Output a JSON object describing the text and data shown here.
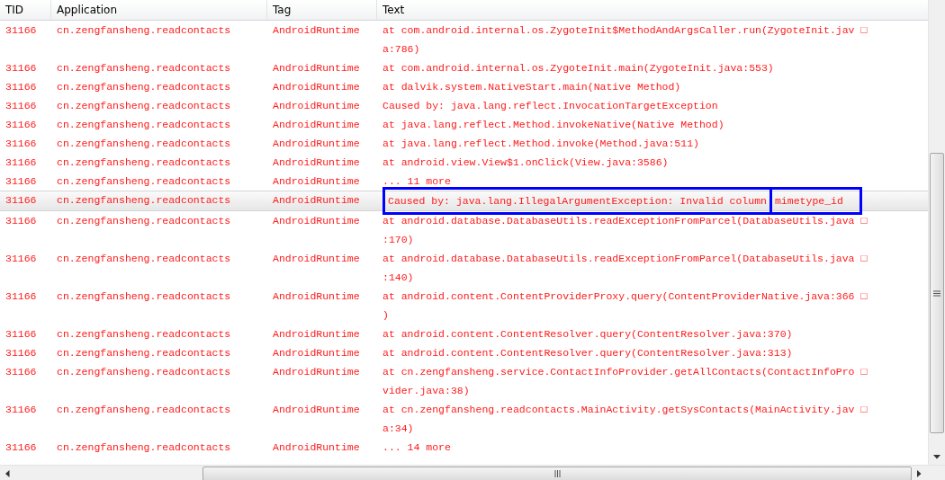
{
  "table": {
    "columns": [
      "TID",
      "Application",
      "Tag",
      "Text"
    ],
    "rows": [
      {
        "tid": "31166",
        "application": "cn.zengfansheng.readcontacts",
        "tag": "AndroidRuntime",
        "selected": false,
        "lines": [
          "at com.android.internal.os.ZygoteInit$MethodAndArgsCaller.run(ZygoteInit.jav □",
          "a:786)"
        ]
      },
      {
        "tid": "31166",
        "application": "cn.zengfansheng.readcontacts",
        "tag": "AndroidRuntime",
        "selected": false,
        "lines": [
          "at com.android.internal.os.ZygoteInit.main(ZygoteInit.java:553)"
        ]
      },
      {
        "tid": "31166",
        "application": "cn.zengfansheng.readcontacts",
        "tag": "AndroidRuntime",
        "selected": false,
        "lines": [
          "at dalvik.system.NativeStart.main(Native Method)"
        ]
      },
      {
        "tid": "31166",
        "application": "cn.zengfansheng.readcontacts",
        "tag": "AndroidRuntime",
        "selected": false,
        "lines": [
          "Caused by: java.lang.reflect.InvocationTargetException"
        ]
      },
      {
        "tid": "31166",
        "application": "cn.zengfansheng.readcontacts",
        "tag": "AndroidRuntime",
        "selected": false,
        "lines": [
          "at java.lang.reflect.Method.invokeNative(Native Method)"
        ]
      },
      {
        "tid": "31166",
        "application": "cn.zengfansheng.readcontacts",
        "tag": "AndroidRuntime",
        "selected": false,
        "lines": [
          "at java.lang.reflect.Method.invoke(Method.java:511)"
        ]
      },
      {
        "tid": "31166",
        "application": "cn.zengfansheng.readcontacts",
        "tag": "AndroidRuntime",
        "selected": false,
        "lines": [
          "at android.view.View$1.onClick(View.java:3586)"
        ]
      },
      {
        "tid": "31166",
        "application": "cn.zengfansheng.readcontacts",
        "tag": "AndroidRuntime",
        "selected": false,
        "lines": [
          "... 11 more"
        ]
      },
      {
        "tid": "31166",
        "application": "cn.zengfansheng.readcontacts",
        "tag": "AndroidRuntime",
        "selected": true,
        "segments": [
          "Caused by: java.lang.IllegalArgumentException: Invalid column",
          "mimetype_id"
        ]
      },
      {
        "tid": "31166",
        "application": "cn.zengfansheng.readcontacts",
        "tag": "AndroidRuntime",
        "selected": false,
        "lines": [
          "at android.database.DatabaseUtils.readExceptionFromParcel(DatabaseUtils.java □",
          ":170)"
        ]
      },
      {
        "tid": "31166",
        "application": "cn.zengfansheng.readcontacts",
        "tag": "AndroidRuntime",
        "selected": false,
        "lines": [
          "at android.database.DatabaseUtils.readExceptionFromParcel(DatabaseUtils.java □",
          ":140)"
        ]
      },
      {
        "tid": "31166",
        "application": "cn.zengfansheng.readcontacts",
        "tag": "AndroidRuntime",
        "selected": false,
        "lines": [
          "at android.content.ContentProviderProxy.query(ContentProviderNative.java:366 □",
          ")"
        ]
      },
      {
        "tid": "31166",
        "application": "cn.zengfansheng.readcontacts",
        "tag": "AndroidRuntime",
        "selected": false,
        "lines": [
          "at android.content.ContentResolver.query(ContentResolver.java:370)"
        ]
      },
      {
        "tid": "31166",
        "application": "cn.zengfansheng.readcontacts",
        "tag": "AndroidRuntime",
        "selected": false,
        "lines": [
          "at android.content.ContentResolver.query(ContentResolver.java:313)"
        ]
      },
      {
        "tid": "31166",
        "application": "cn.zengfansheng.readcontacts",
        "tag": "AndroidRuntime",
        "selected": false,
        "lines": [
          "at cn.zengfansheng.service.ContactInfoProvider.getAllContacts(ContactInfoPro □",
          "vider.java:38)"
        ]
      },
      {
        "tid": "31166",
        "application": "cn.zengfansheng.readcontacts",
        "tag": "AndroidRuntime",
        "selected": false,
        "lines": [
          "at cn.zengfansheng.readcontacts.MainActivity.getSysContacts(MainActivity.jav □",
          "a:34)"
        ]
      },
      {
        "tid": "31166",
        "application": "cn.zengfansheng.readcontacts",
        "tag": "AndroidRuntime",
        "selected": false,
        "lines": [
          "... 14 more"
        ]
      }
    ]
  }
}
